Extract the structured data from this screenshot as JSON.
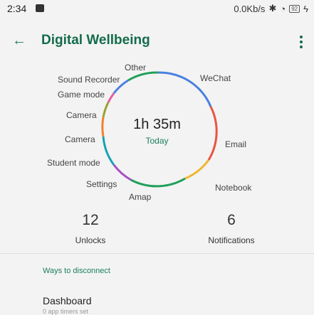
{
  "status": {
    "time": "2:34",
    "network": "0.0Kb/s",
    "battery": "92"
  },
  "header": {
    "title": "Digital Wellbeing"
  },
  "wheel": {
    "total": "1h 35m",
    "period": "Today",
    "labels": [
      "Other",
      "WeChat",
      "Sound Recorder",
      "Game mode",
      "Camera",
      "Camera",
      "Email",
      "Student mode",
      "Settings",
      "Notebook",
      "Amap"
    ],
    "colors": {
      "blue": "#4a80e0",
      "red": "#e9543f",
      "yellow": "#f0b630",
      "green": "#21a05a",
      "purple": "#a84fc4",
      "cyan": "#17a2b8",
      "pink": "#e65ea0",
      "olive": "#9aa22b",
      "orange": "#f08030"
    }
  },
  "stats": {
    "unlocks": {
      "value": "12",
      "label": "Unlocks"
    },
    "notifications": {
      "value": "6",
      "label": "Notifications"
    }
  },
  "section": {
    "title": "Ways to disconnect"
  },
  "dashboard": {
    "title": "Dashboard",
    "subtitle": "0 app timers set"
  }
}
